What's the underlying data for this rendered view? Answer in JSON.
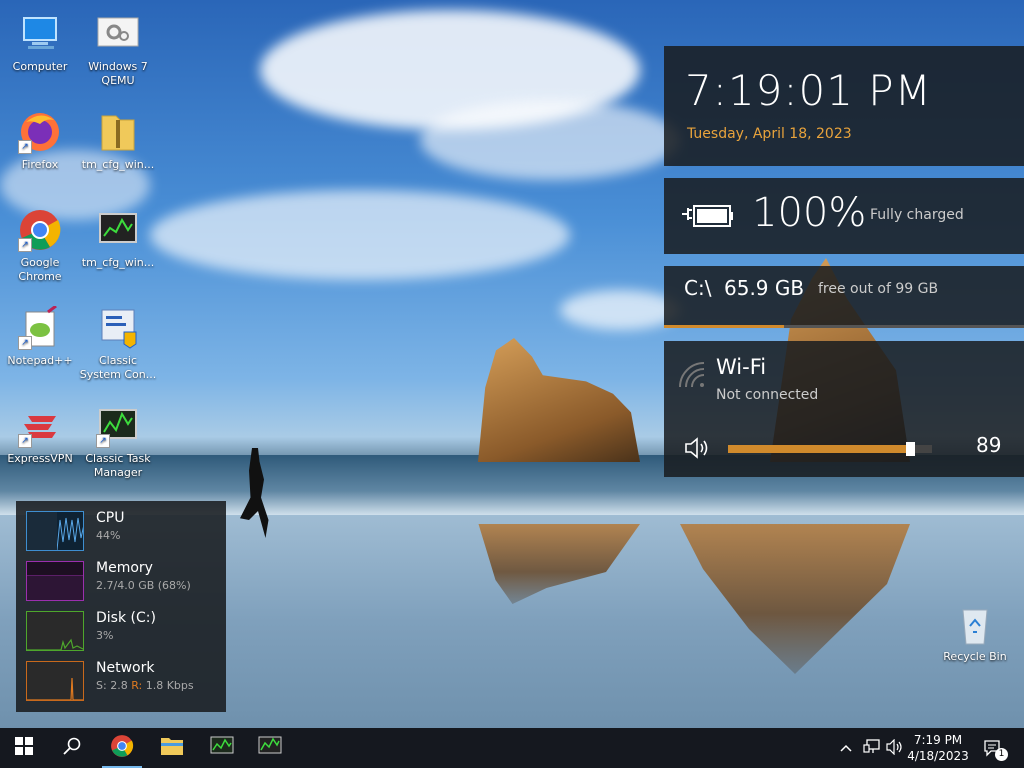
{
  "desktop_icons": [
    {
      "name": "computer",
      "label": "Computer"
    },
    {
      "name": "windows7-qemu",
      "label": "Windows 7 QEMU"
    },
    {
      "name": "firefox",
      "label": "Firefox"
    },
    {
      "name": "tm-cfg-zip",
      "label": "tm_cfg_win..."
    },
    {
      "name": "google-chrome",
      "label": "Google Chrome"
    },
    {
      "name": "tm-cfg-app",
      "label": "tm_cfg_win..."
    },
    {
      "name": "notepadpp",
      "label": "Notepad++"
    },
    {
      "name": "classic-system-control",
      "label": "Classic System Con..."
    },
    {
      "name": "expressvpn",
      "label": "ExpressVPN"
    },
    {
      "name": "classic-task-manager",
      "label": "Classic Task Manager"
    },
    {
      "name": "recycle-bin",
      "label": "Recycle Bin"
    }
  ],
  "clock_widget": {
    "time": "7:19:01 PM",
    "date": "Tuesday, April 18, 2023"
  },
  "battery_widget": {
    "percent": "100%",
    "status": "Fully charged"
  },
  "drive_widget": {
    "drive": "C:\\",
    "free": "65.9 GB",
    "detail": "free out of 99 GB",
    "used_fraction": 0.334
  },
  "wifi_widget": {
    "title": "Wi-Fi",
    "status": "Not connected"
  },
  "volume_widget": {
    "value": "89",
    "level": 0.89
  },
  "perf_monitor": {
    "cpu": {
      "name": "CPU",
      "value": "44%"
    },
    "memory": {
      "name": "Memory",
      "value": "2.7/4.0 GB (68%)"
    },
    "disk": {
      "name": "Disk (C:)",
      "value": "3%"
    },
    "network": {
      "name": "Network",
      "send_label": "S:",
      "send": "2.8",
      "recv_label": "R:",
      "recv": "1.8 Kbps"
    }
  },
  "taskbar": {
    "clock_time": "7:19 PM",
    "clock_date": "4/18/2023",
    "notification_count": "1",
    "pinned": [
      "start",
      "search",
      "chrome",
      "file-explorer",
      "task-manager",
      "system-monitor"
    ]
  },
  "colors": {
    "accent_orange": "#d08a2c",
    "date_orange": "#e8a33c",
    "cpu": "#3e8ed0",
    "memory": "#9b2fae",
    "disk": "#4ea72c",
    "network": "#c8691c"
  }
}
